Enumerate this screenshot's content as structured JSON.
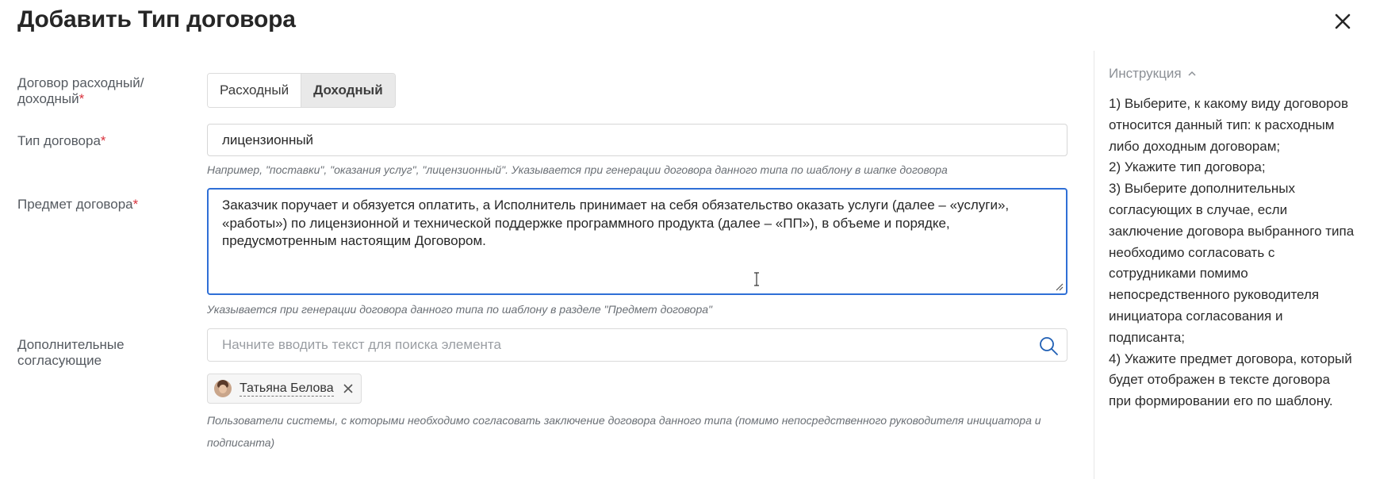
{
  "dialog": {
    "title": "Добавить Тип договора"
  },
  "form": {
    "direction": {
      "label_line1": "Договор расходный/",
      "label_line2": "доходный",
      "required_mark": "*",
      "options": [
        "Расходный",
        "Доходный"
      ],
      "selected": "Доходный"
    },
    "contract_type": {
      "label": "Тип договора",
      "required_mark": "*",
      "value": "лицензионный",
      "hint": "Например, \"поставки\", \"оказания услуг\", \"лицензионный\". Указывается при генерации договора данного типа по шаблону в шапке договора"
    },
    "subject": {
      "label": "Предмет договора",
      "required_mark": "*",
      "value_lines": [
        "Заказчик поручает и обязуется оплатить, а Исполнитель принимает на себя обязательство оказать услуги (далее – «услуги»,",
        "«работы») по лицензионной и технической поддержке программного продукта (далее – «ПП»), в объеме и порядке,",
        "предусмотренным настоящим Договором."
      ],
      "hint": "Указывается при генерации договора данного типа по шаблону в разделе \"Предмет договора\""
    },
    "approvers": {
      "label_line1": "Дополнительные",
      "label_line2": "согласующие",
      "search_placeholder": "Начните вводить текст для поиска элемента",
      "selected": [
        {
          "name": "Татьяна Белова"
        }
      ],
      "hint_line1": "Пользователи системы, с которыми необходимо согласовать заключение договора данного типа (помимо непосредственного руководителя инициатора и",
      "hint_line2": "подписанта)"
    }
  },
  "instructions": {
    "header": "Инструкция",
    "lines": [
      "1) Выберите, к какому виду договоров",
      "относится данный тип: к расходным",
      "либо доходным договорам;",
      "2) Укажите тип договора;",
      "3) Выберите дополнительных",
      "согласующих в случае, если",
      "заключение договора выбранного типа",
      "необходимо согласовать с",
      "сотрудниками помимо",
      "непосредственного руководителя",
      "инициатора согласования и",
      "подписанта;",
      "4) Укажите предмет договора, который",
      "будет отображен в тексте договора",
      "при формировании его по шаблону."
    ]
  },
  "colors": {
    "accent_focus": "#2f6fd6",
    "required": "#d9323c",
    "search_icon": "#1f5fb4"
  }
}
